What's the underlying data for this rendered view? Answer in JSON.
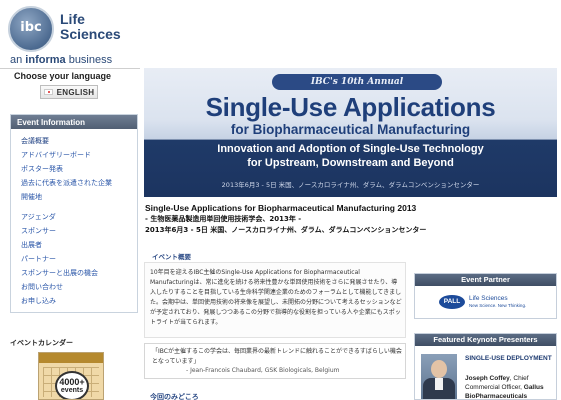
{
  "logo": {
    "badge": "ibc",
    "line1": "Life",
    "line2": "Sciences",
    "tagline_pre": "an ",
    "tagline_bold": "informa",
    "tagline_post": " business"
  },
  "language": {
    "heading": "Choose your language",
    "button_label": "ENGLISH"
  },
  "event_info": {
    "heading": "Event Information",
    "items": [
      {
        "label": "会議概要"
      },
      {
        "label": "アドバイザリーボード"
      },
      {
        "label": "ポスター発表"
      },
      {
        "label": "過去に代表を派遣された企業"
      },
      {
        "label": "開催地"
      },
      {
        "label": "アジェンダ"
      },
      {
        "label": "スポンサー"
      },
      {
        "label": "出展者"
      },
      {
        "label": "パートナー"
      },
      {
        "label": "スポンサーと出展の機会"
      },
      {
        "label": "お問い合わせ"
      },
      {
        "label": "お申し込み"
      }
    ]
  },
  "calendar": {
    "heading": "イベントカレンダー",
    "badge_number": "4000+",
    "badge_word": "events"
  },
  "banner": {
    "tag": "IBC's 10th Annual",
    "title": "Single-Use Applications",
    "subtitle": "for Biopharmaceutical Manufacturing",
    "line1": "Innovation and Adoption of Single-Use Technology",
    "line2": "for Upstream, Downstream and Beyond",
    "date": "2013年6月3 - 5日 米国、ノースカロライナ州、ダラム、ダラムコンベンションセンター"
  },
  "event_title": {
    "line1": "Single-Use Applications for Biopharmaceutical Manufacturing 2013",
    "line2": "- 生物医薬品製造用単回使用技術学会、2013年 -",
    "line3": "2013年6月3 - 5日 米国、ノースカロライナ州、ダラム、ダラムコンベンションセンター"
  },
  "overview": {
    "label": "イベント概要",
    "text": "10年目を迎えるIBC主催のSingle-Use Applications for Biopharmaceutical Manufacturingは、常に進化を続ける将来性豊かな単回使用技術をさらに発展させたり、導入したりすることを目指している生命科学関連企業のためのフォーラムとして機能してきました。会期中は、単回使用技術の将来像を展望し、未開拓の分野について考えるセッションなどが予定されており、発展しつつあるこの分野で指導的な役割を担っている人や企業にもスポットライトが当てられます。"
  },
  "quote": {
    "text": "「IBCが主催するこの学会は、毎回業界の最新トレンドに触れることができるすばらしい機会となっています」",
    "author": "- Jean-Francois Chaubard, GSK Biologicals, Belgium"
  },
  "highlights": {
    "label": "今回のみどころ"
  },
  "partner": {
    "heading": "Event Partner",
    "logo_mark": "PALL",
    "logo_text": "Life Sciences",
    "logo_sub": "New Science. New Thinking."
  },
  "keynote": {
    "heading": "Featured Keynote Presenters",
    "topic": "SINGLE-USE DEPLOYMENT",
    "name": "Joseph Coffey",
    "role": ", Chief Commercial Officer, ",
    "company": "Gallus BioPharmaceuticals"
  },
  "colors": {
    "nav_link": "#2a56a8",
    "banner_dark": "#1c3460",
    "panel_head": "#4f5f77"
  }
}
